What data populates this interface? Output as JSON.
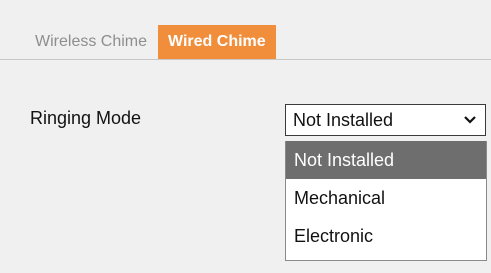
{
  "tabs": [
    {
      "label": "Wireless Chime",
      "active": false
    },
    {
      "label": "Wired Chime",
      "active": true
    }
  ],
  "ringing_mode": {
    "label": "Ringing Mode",
    "selected": "Not Installed",
    "options": [
      "Not Installed",
      "Mechanical",
      "Electronic"
    ],
    "highlighted_index": 0
  },
  "colors": {
    "active_tab": "#f08e3c",
    "highlight": "#6e6e6e",
    "background": "#f0f0f0"
  },
  "icons": {
    "dropdown": "chevron-down-icon"
  }
}
